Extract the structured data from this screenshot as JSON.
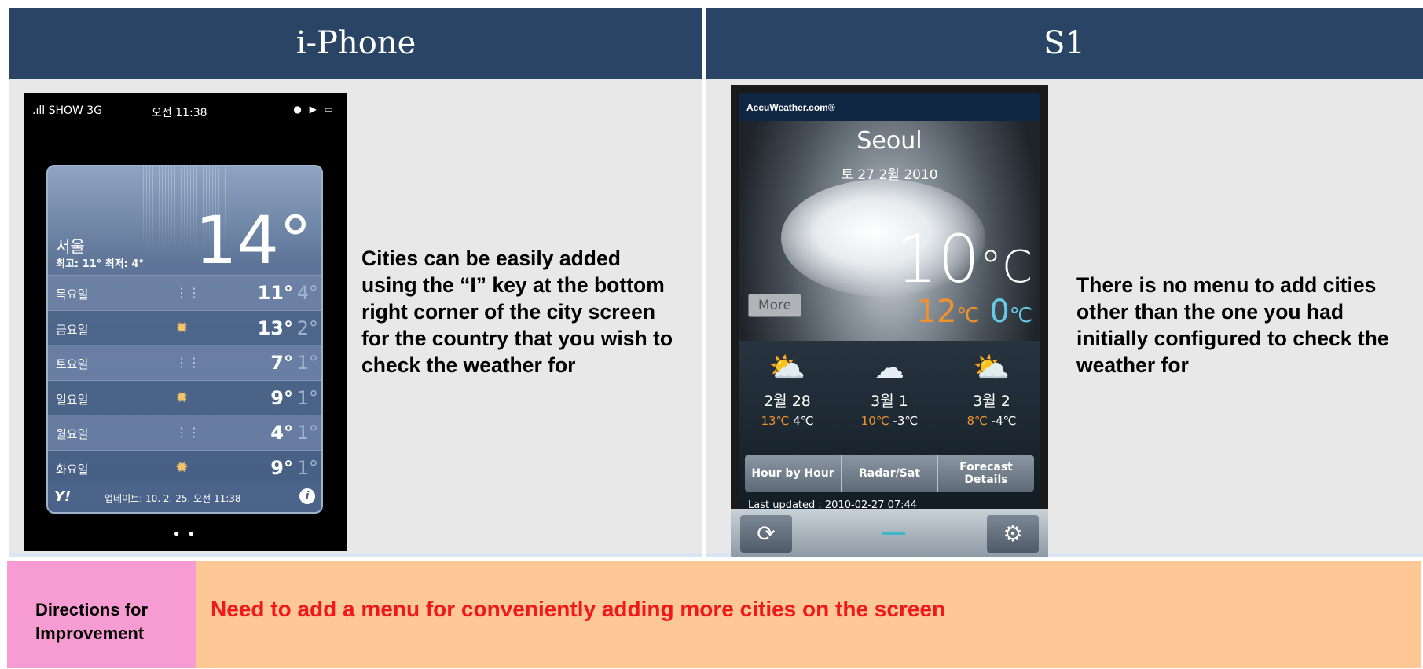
{
  "left_panel": {
    "title": "i-Phone",
    "description": "Cities can be easily added using the “I” key at the bottom right corner of the city screen for the country that you wish to check the weather for",
    "screenshot": {
      "status_carrier": ".ıll SHOW  3G",
      "status_time": "오전 11:38",
      "status_icons": "● ▶ ▭",
      "city": "서울",
      "hi_lo": "최고: 11° 최저: 4°",
      "current_temp": "14°",
      "forecast": [
        {
          "day": "목요일",
          "icon": "rain-icon",
          "hi": "11°",
          "lo": "4°"
        },
        {
          "day": "금요일",
          "icon": "sun-icon",
          "hi": "13°",
          "lo": "2°"
        },
        {
          "day": "토요일",
          "icon": "rain-icon",
          "hi": "7°",
          "lo": "1°"
        },
        {
          "day": "일요일",
          "icon": "sun-icon",
          "hi": "9°",
          "lo": "1°"
        },
        {
          "day": "월요일",
          "icon": "rain-icon",
          "hi": "4°",
          "lo": "1°"
        },
        {
          "day": "화요일",
          "icon": "sun-icon",
          "hi": "9°",
          "lo": "1°"
        }
      ],
      "yahoo_logo": "Y!",
      "updated": "업데이트: 10. 2. 25. 오전 11:38",
      "info_symbol": "i",
      "page_dots": "● ●"
    }
  },
  "right_panel": {
    "title": "S1",
    "description": "There is no menu to add cities other than the one you had initially configured to check the weather for",
    "screenshot": {
      "brand": "AccuWeather.com®",
      "city": "Seoul",
      "date": "토 27 2월 2010",
      "current_temp": "10",
      "temp_unit": "°C",
      "hi": "12",
      "lo": "0",
      "more_label": "More",
      "forecast": [
        {
          "date": "2월 28",
          "icon": "sun-cloud-icon",
          "hi": "13℃",
          "lo": "4℃"
        },
        {
          "date": "3월 1",
          "icon": "rain-cloud-icon",
          "hi": "10℃",
          "lo": "-3℃"
        },
        {
          "date": "3월 2",
          "icon": "sun-cloud-icon",
          "hi": "8℃",
          "lo": "-4℃"
        }
      ],
      "buttons": [
        "Hour by Hour",
        "Radar/Sat",
        "Forecast Details"
      ],
      "last_updated": "Last updated : 2010-02-27 07:44",
      "refresh_symbol": "⟳",
      "gear_symbol": "⚙"
    }
  },
  "improvement": {
    "label": "Directions for Improvement",
    "text": "Need to add a menu for conveniently adding more cities on the screen"
  },
  "colors": {
    "header_bg": "#2a4466",
    "improvement_bg": "#fdc895",
    "label_bg": "#f79cd2",
    "improvement_text": "#f01818"
  }
}
